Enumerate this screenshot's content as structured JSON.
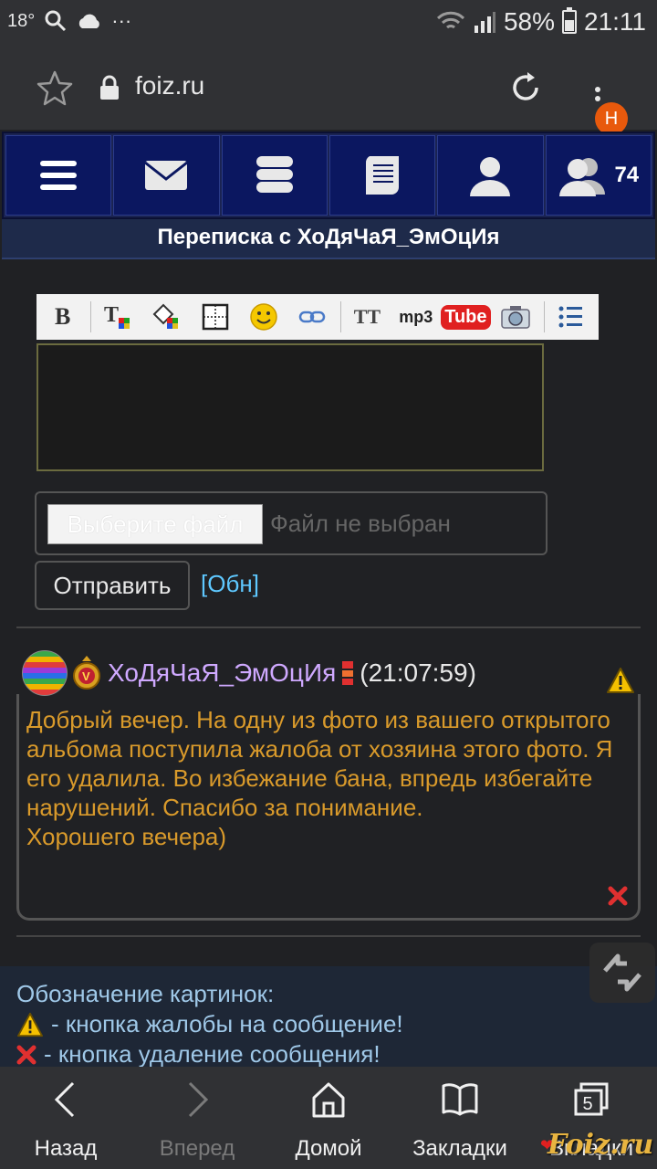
{
  "status_bar": {
    "temperature": "18°",
    "dots": "···",
    "battery": "58%",
    "time": "21:11"
  },
  "browser": {
    "url": "foiz.ru",
    "profile_badge": "H"
  },
  "site_nav": {
    "online_count": "74"
  },
  "page": {
    "title": "Переписка с ХоДяЧаЯ_ЭмОцИя"
  },
  "toolbar": {
    "bold": "B",
    "text_size": "TT",
    "mp3": "mp3",
    "youtube": "Tube"
  },
  "form": {
    "file_button": "Выберите файл",
    "file_status": "Файл не выбран",
    "send_button": "Отправить",
    "refresh_link": "[Обн]"
  },
  "message": {
    "author": "ХоДяЧаЯ_ЭмОцИя",
    "time": "(21:07:59)",
    "text": "Добрый вечер. На одну из фото из вашего открытого альбома поступила жалоба от хозяина этого фото. Я его удалила. Во избежание бана, впредь избегайте нарушений. Спасибо за понимание.\nХорошего вечера)"
  },
  "legend": {
    "title": "Обозначение картинок:",
    "complaint": "- кнопка жалобы на сообщение!",
    "delete": "- кнопка удаление сообщения!"
  },
  "bottom_nav": {
    "back": "Назад",
    "forward": "Вперед",
    "home": "Домой",
    "bookmarks": "Закладки",
    "tabs": "Вкладки",
    "tabs_count": "5"
  },
  "watermark": "Foiz.ru",
  "colors": {
    "nav_bg": "#0b1760",
    "message_text": "#d99a2b",
    "username": "#cfa9ff",
    "link": "#5ec8ff",
    "badge": "#e8590c"
  }
}
